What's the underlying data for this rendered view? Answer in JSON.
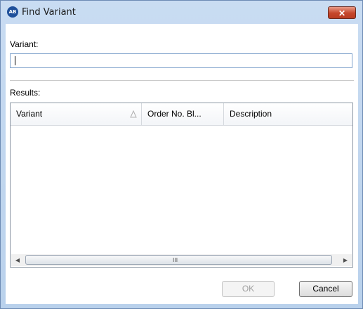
{
  "window": {
    "title": "Find Variant",
    "icon_text": "AB",
    "close_symbol": "✕"
  },
  "search": {
    "label": "Variant:",
    "value": ""
  },
  "results": {
    "label": "Results:",
    "columns": [
      {
        "label": "Variant",
        "sort_icon": "sort-ascending-icon"
      },
      {
        "label": "Order No. Bl..."
      },
      {
        "label": "Description"
      }
    ],
    "rows": []
  },
  "scrollbar": {
    "left_arrow": "◀",
    "right_arrow": "▶",
    "grip": "III"
  },
  "buttons": {
    "ok": "OK",
    "cancel": "Cancel"
  },
  "colors": {
    "titlebar": "#c9dcf2",
    "close": "#c5462b",
    "input_border": "#7fa2cc"
  }
}
